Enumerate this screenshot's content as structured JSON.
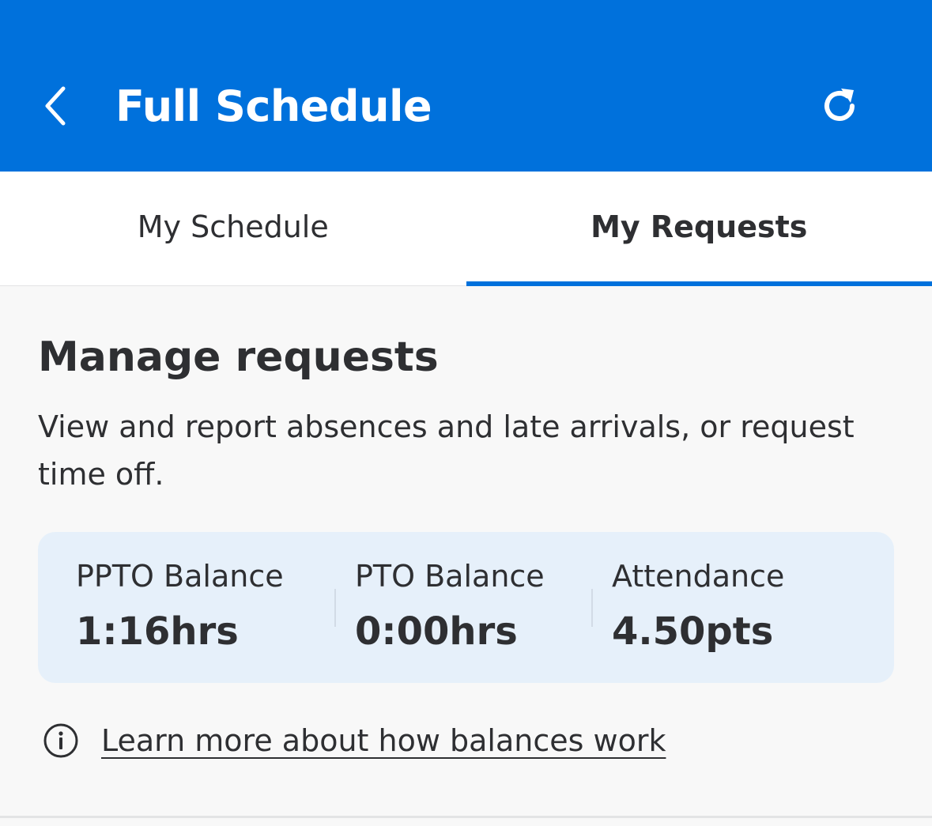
{
  "header": {
    "title": "Full Schedule",
    "back_icon": "chevron-left-icon",
    "refresh_icon": "refresh-icon",
    "color": "#0071dc"
  },
  "tabs": [
    {
      "label": "My Schedule",
      "active": false
    },
    {
      "label": "My Requests",
      "active": true
    }
  ],
  "manage": {
    "title": "Manage requests",
    "description": "View and report absences and late arrivals, or request time off."
  },
  "balances": [
    {
      "label": "PPTO Balance",
      "value": "1:16hrs"
    },
    {
      "label": "PTO Balance",
      "value": "0:00hrs"
    },
    {
      "label": "Attendance",
      "value": "4.50pts"
    }
  ],
  "info": {
    "icon": "info-icon",
    "link_text": "Learn more about how balances work"
  }
}
